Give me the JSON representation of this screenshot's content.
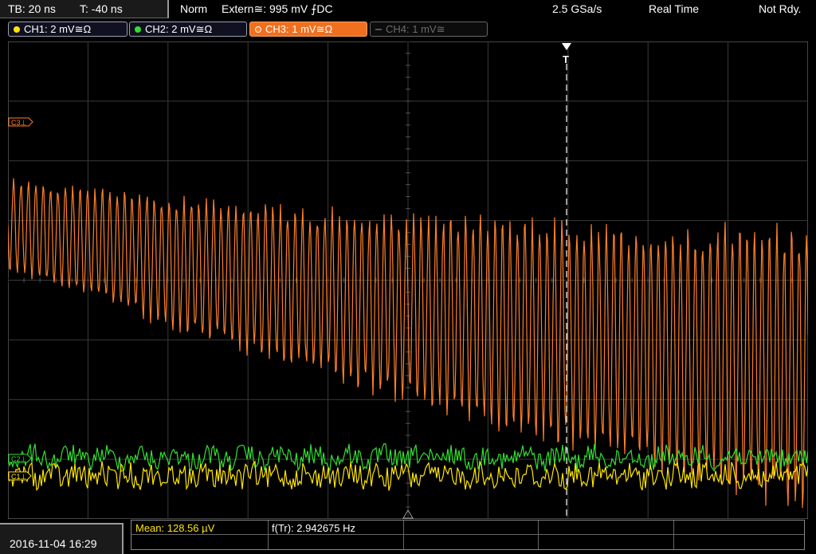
{
  "top": {
    "timebase": "TB: 20 ns",
    "trigger_offset": "T: -40 ns",
    "trigger_mode": "Norm",
    "trigger_source": "Extern≅: 995 mV ⨍DC",
    "sample_rate": "2.5 GSa/s",
    "acq_mode": "Real Time",
    "status": "Not Rdy."
  },
  "channels": [
    {
      "label": "CH1: 2 mV≅Ω",
      "color": "#ffe600",
      "state": "on"
    },
    {
      "label": "CH2: 2 mV≅Ω",
      "color": "#30e030",
      "state": "on"
    },
    {
      "label": "CH3: 1 mV≅Ω",
      "color": "#ff7f27",
      "state": "active"
    },
    {
      "label": "CH4: 1 mV≅",
      "color": "#555555",
      "state": "off"
    }
  ],
  "markers": {
    "ch3": "C3⊥",
    "ch2": "C2⊥",
    "ch1": "C1⊥",
    "trigger": "T"
  },
  "footer": {
    "datetime": "2016-11-04 16:29",
    "measurement_1": "Mean: 128.56 µV",
    "measurement_2": "f(Tr): 2.942675 Hz"
  },
  "colors": {
    "ch1": "#ffe600",
    "ch2": "#30e030",
    "ch3": "#ff7f27",
    "grid": "#3a3a3a",
    "trigger_line": "#ffffff"
  }
}
